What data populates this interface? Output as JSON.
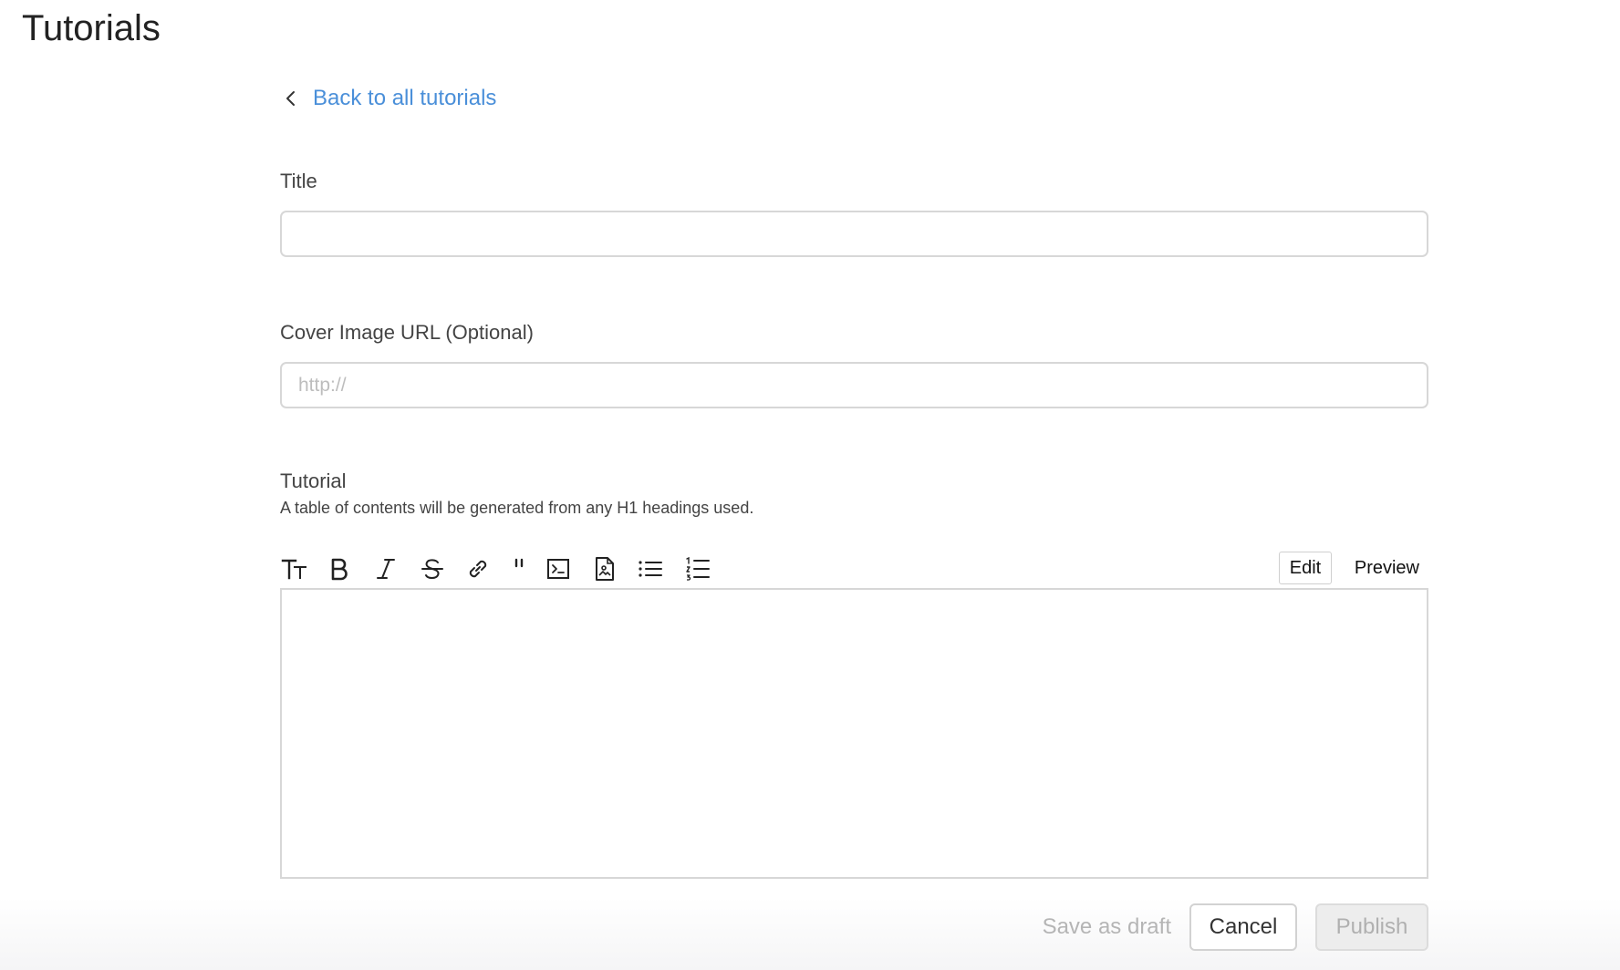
{
  "page": {
    "title": "Tutorials"
  },
  "back_link": {
    "label": "Back to all tutorials",
    "icon": "chevron-left-icon",
    "color": "#4a8fd9"
  },
  "form": {
    "title_field": {
      "label": "Title",
      "value": "",
      "placeholder": ""
    },
    "cover_image_field": {
      "label": "Cover Image URL (Optional)",
      "value": "",
      "placeholder": "http://"
    },
    "tutorial_field": {
      "label": "Tutorial",
      "helper": "A table of contents will be generated from any H1 headings used.",
      "value": ""
    }
  },
  "editor_toolbar": {
    "tools": [
      {
        "name": "heading-icon",
        "title": "Heading"
      },
      {
        "name": "bold-icon",
        "title": "Bold"
      },
      {
        "name": "italic-icon",
        "title": "Italic"
      },
      {
        "name": "strikethrough-icon",
        "title": "Strikethrough"
      },
      {
        "name": "link-icon",
        "title": "Link"
      },
      {
        "name": "quote-icon",
        "title": "Quote"
      },
      {
        "name": "code-icon",
        "title": "Code"
      },
      {
        "name": "image-icon",
        "title": "Image"
      },
      {
        "name": "bulleted-list-icon",
        "title": "Bulleted list"
      },
      {
        "name": "numbered-list-icon",
        "title": "Numbered list"
      }
    ],
    "modes": {
      "edit": "Edit",
      "preview": "Preview",
      "active": "edit"
    }
  },
  "actions": {
    "save_draft": "Save as draft",
    "cancel": "Cancel",
    "publish": "Publish"
  }
}
